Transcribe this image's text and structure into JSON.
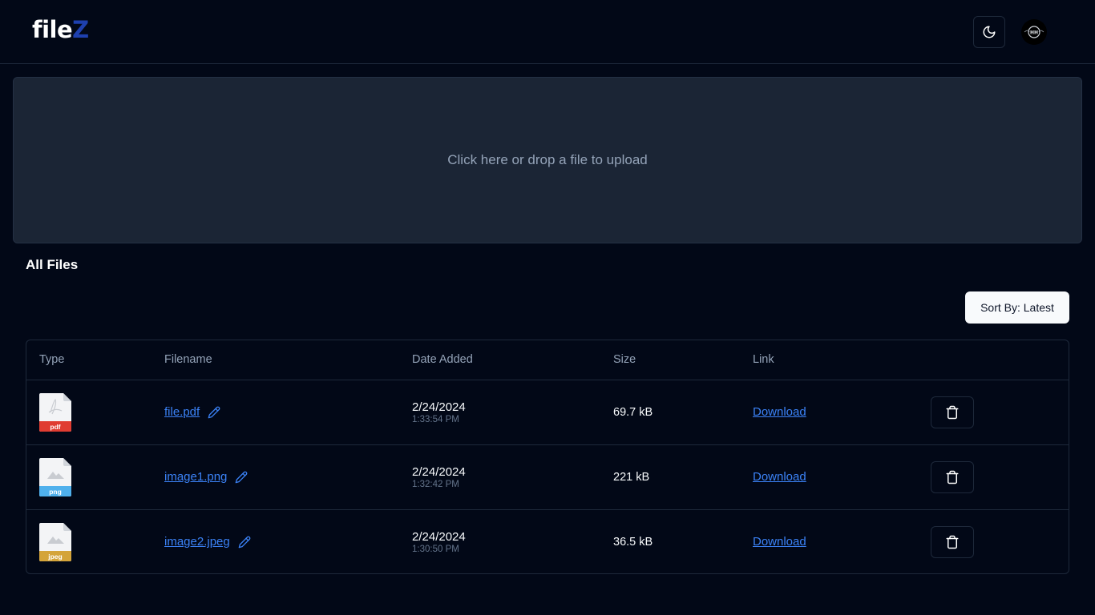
{
  "header": {
    "logo_part1": "file",
    "logo_part2": "Z",
    "theme_toggle_icon": "moon-icon",
    "avatar_icon": "user-avatar"
  },
  "upload": {
    "prompt": "Click here or drop a file to upload"
  },
  "files_section": {
    "title": "All Files",
    "sort_label": "Sort By: Latest"
  },
  "table": {
    "columns": [
      "Type",
      "Filename",
      "Date Added",
      "Size",
      "Link",
      ""
    ],
    "rows": [
      {
        "type": "pdf",
        "type_color": "#e03c31",
        "icon": "pdf-file-icon",
        "filename": "file.pdf",
        "date": "2/24/2024",
        "time": "1:33:54 PM",
        "size": "69.7 kB",
        "link_label": "Download"
      },
      {
        "type": "png",
        "type_color": "#4fb0ec",
        "icon": "image-file-icon",
        "filename": "image1.png",
        "date": "2/24/2024",
        "time": "1:32:42 PM",
        "size": "221 kB",
        "link_label": "Download"
      },
      {
        "type": "jpeg",
        "type_color": "#d4a43a",
        "icon": "image-file-icon",
        "filename": "image2.jpeg",
        "date": "2/24/2024",
        "time": "1:30:50 PM",
        "size": "36.5 kB",
        "link_label": "Download"
      }
    ]
  },
  "colors": {
    "background": "#020817",
    "accent": "#1e40af",
    "link": "#3b82f6",
    "dropzone": "#1b2535"
  }
}
